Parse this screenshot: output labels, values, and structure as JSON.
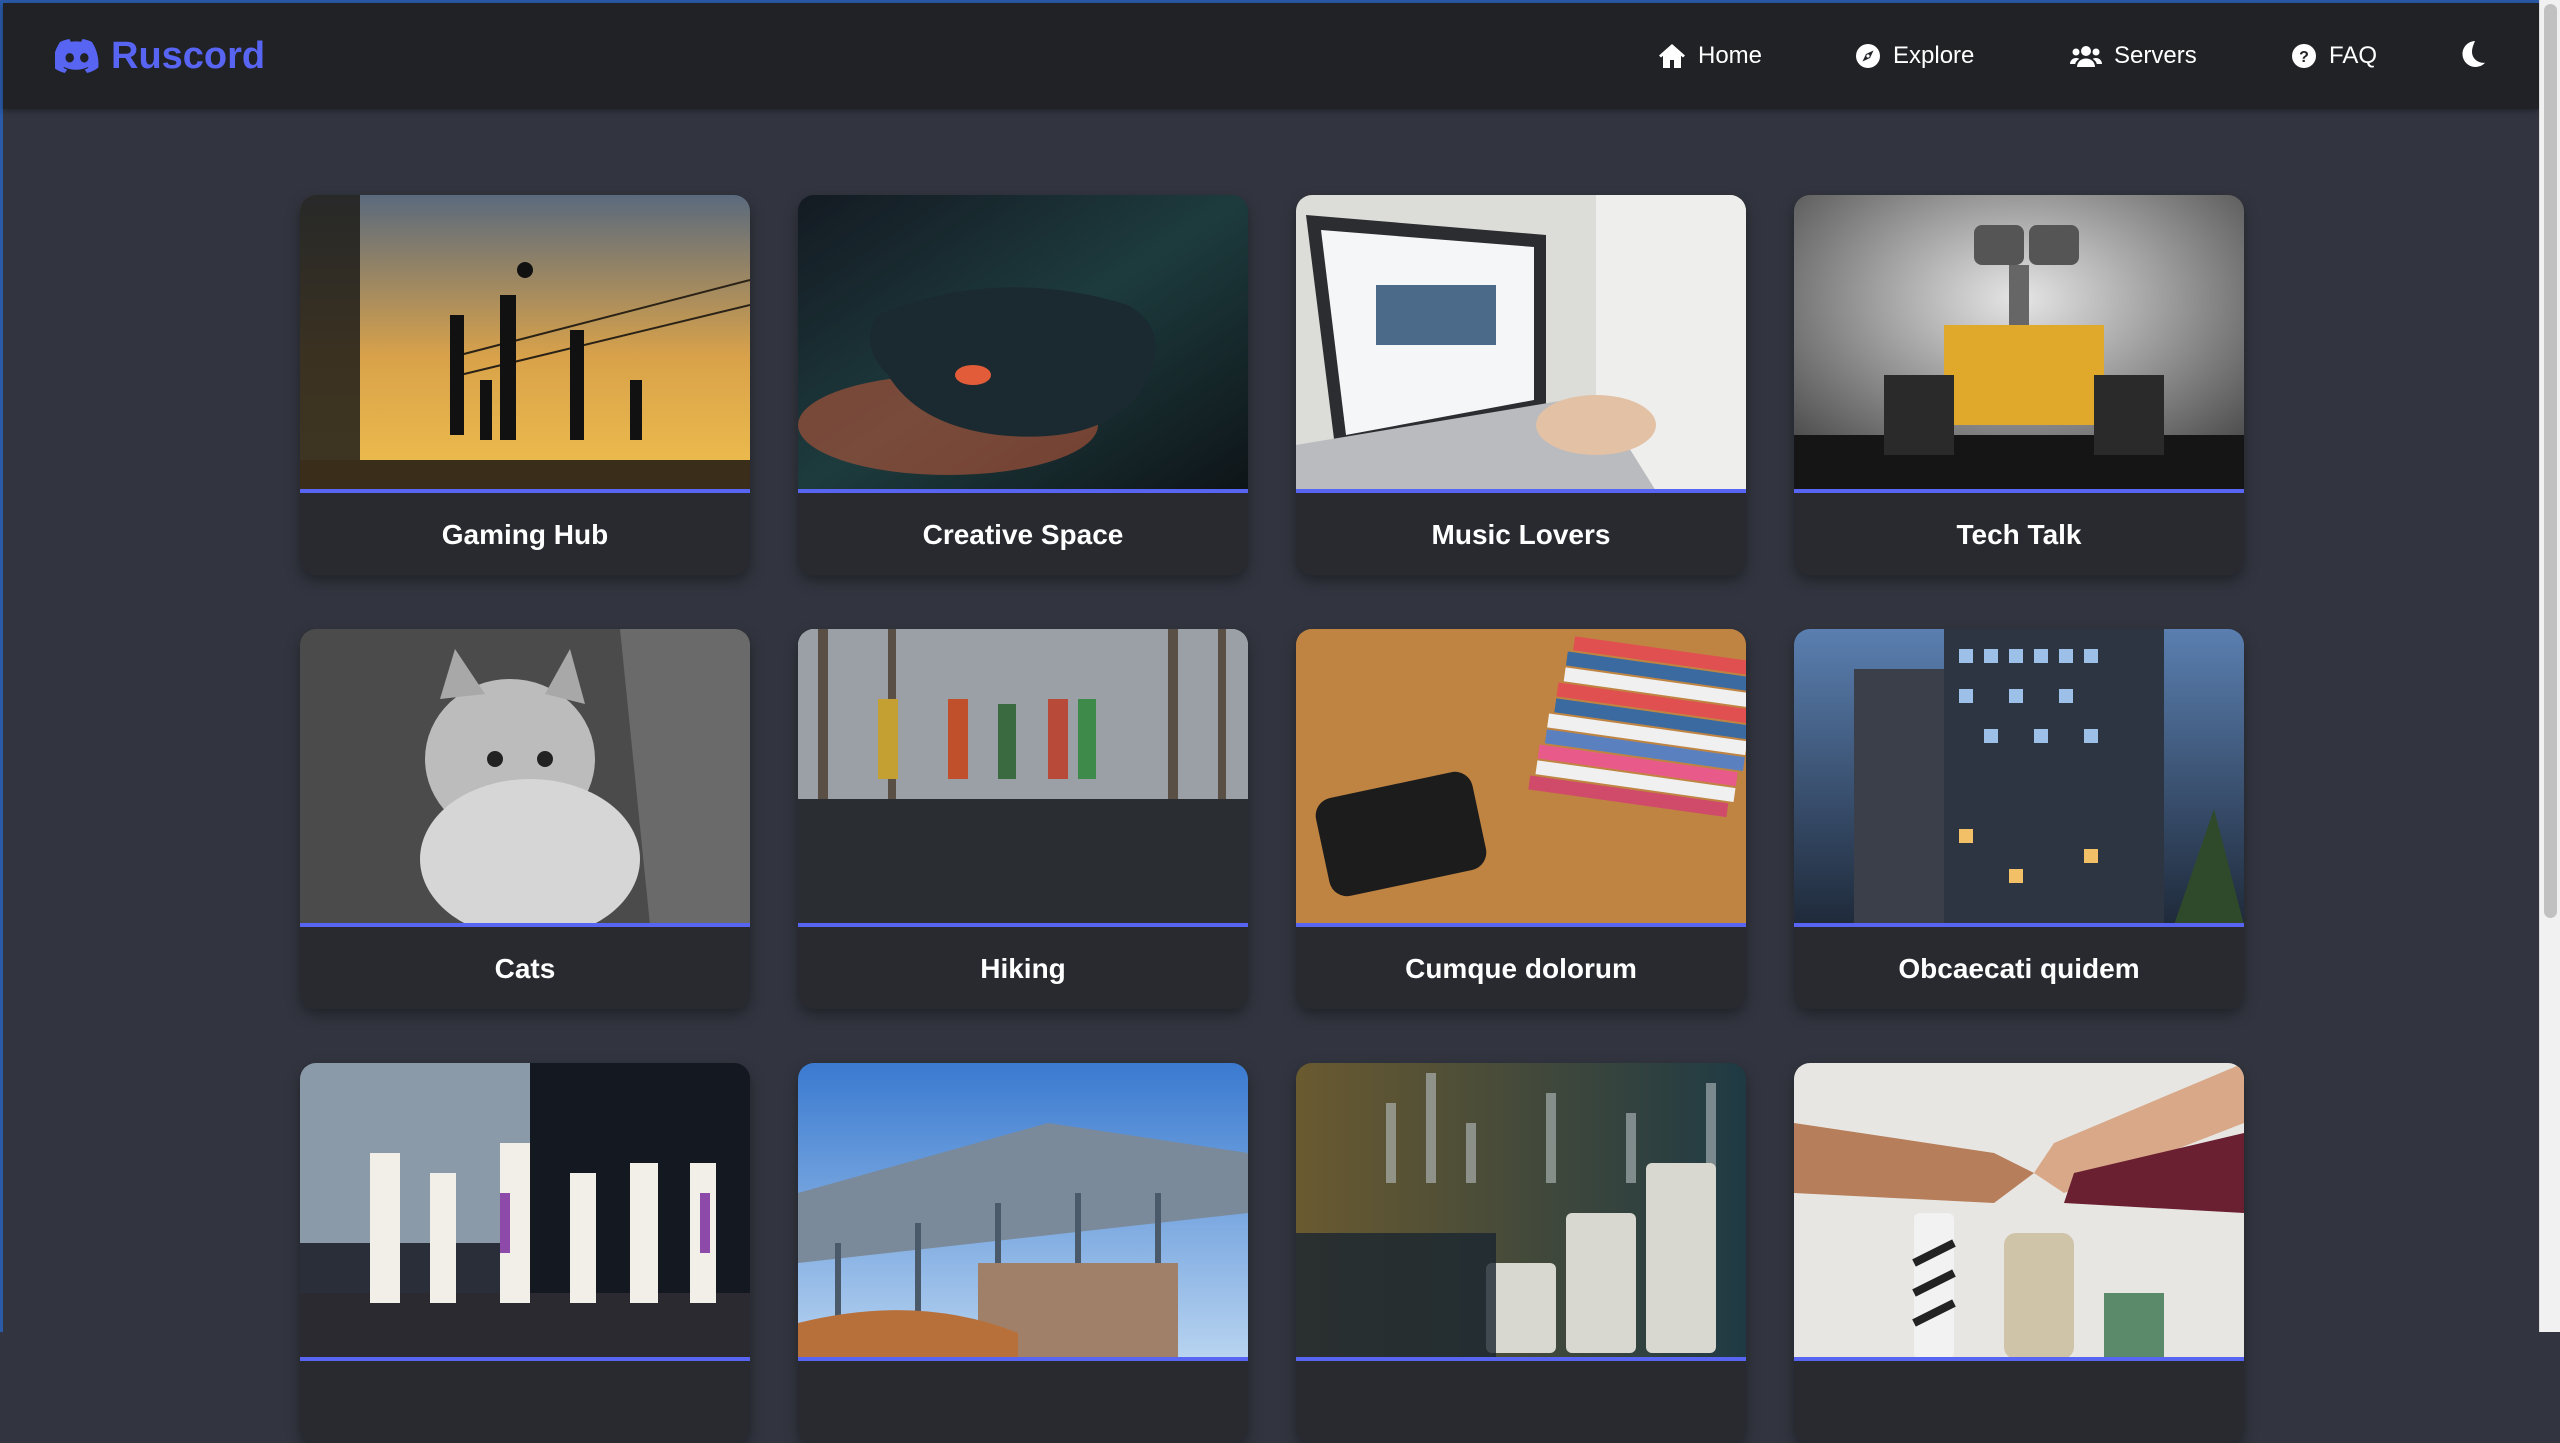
{
  "brand": {
    "name": "Ruscord",
    "icon": "discord-logo-icon",
    "color": "#5865f2"
  },
  "nav": {
    "items": [
      {
        "label": "Home",
        "icon": "home-icon"
      },
      {
        "label": "Explore",
        "icon": "compass-icon"
      },
      {
        "label": "Servers",
        "icon": "users-icon"
      },
      {
        "label": "FAQ",
        "icon": "question-circle-icon"
      }
    ],
    "theme_toggle_icon": "moon-icon"
  },
  "cards": [
    {
      "title": "Gaming Hub"
    },
    {
      "title": "Creative Space"
    },
    {
      "title": "Music Lovers"
    },
    {
      "title": "Tech Talk"
    },
    {
      "title": "Cats"
    },
    {
      "title": "Hiking"
    },
    {
      "title": "Cumque dolorum"
    },
    {
      "title": "Obcaecati quidem"
    },
    {
      "title": ""
    },
    {
      "title": ""
    },
    {
      "title": ""
    },
    {
      "title": ""
    }
  ],
  "colors": {
    "accent": "#5865f2",
    "background": "#32353f",
    "navbar": "#202226",
    "card": "#282a30"
  }
}
